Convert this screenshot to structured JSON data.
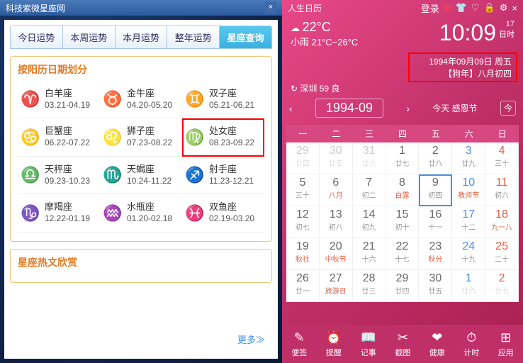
{
  "left": {
    "title": "科技紫微星座网",
    "tabs": [
      "今日运势",
      "本周运势",
      "本月运势",
      "整年运势",
      "星座查询"
    ],
    "activeTab": 4,
    "panel1_title": "按阳历日期划分",
    "zodiac": [
      {
        "icon": "♈",
        "name": "白羊座",
        "range": "03.21-04.19"
      },
      {
        "icon": "♉",
        "name": "金牛座",
        "range": "04.20-05.20"
      },
      {
        "icon": "♊",
        "name": "双子座",
        "range": "05.21-06.21"
      },
      {
        "icon": "♋",
        "name": "巨蟹座",
        "range": "06.22-07.22"
      },
      {
        "icon": "♌",
        "name": "狮子座",
        "range": "07.23-08.22"
      },
      {
        "icon": "♍",
        "name": "处女座",
        "range": "08.23-09.22"
      },
      {
        "icon": "♎",
        "name": "天秤座",
        "range": "09.23-10.23"
      },
      {
        "icon": "♏",
        "name": "天蝎座",
        "range": "10.24-11.22"
      },
      {
        "icon": "♐",
        "name": "射手座",
        "range": "11.23-12.21"
      },
      {
        "icon": "♑",
        "name": "摩羯座",
        "range": "12.22-01.19"
      },
      {
        "icon": "♒",
        "name": "水瓶座",
        "range": "01.20-02.18"
      },
      {
        "icon": "♓",
        "name": "双鱼座",
        "range": "02.19-03.20"
      }
    ],
    "highlight": 5,
    "panel2_title": "星座热文欣赏",
    "more": "更多≫"
  },
  "right": {
    "title": "人生日历",
    "login": "登录",
    "weather_icon": "☁",
    "temp": "22°C",
    "weather": "小雨 21°C~26°C",
    "time": "10:09",
    "day": "17",
    "day_label": "日时",
    "lunar_line1": "1994年09月09日 周五",
    "lunar_line2": "【狗年】八月初四",
    "loc_refresh": "↻",
    "loc": "深圳 59 良",
    "nav_month": "1994-09",
    "nav_today": "今天 感恩节",
    "today_btn": "今",
    "weekdays": [
      "一",
      "二",
      "三",
      "四",
      "五",
      "六",
      "日"
    ],
    "days": [
      {
        "n": "29",
        "l": "廿四",
        "c": "dim"
      },
      {
        "n": "30",
        "l": "廿五",
        "c": "dim"
      },
      {
        "n": "31",
        "l": "廿六",
        "c": "dim"
      },
      {
        "n": "1",
        "l": "廿七",
        "c": ""
      },
      {
        "n": "2",
        "l": "廿八",
        "c": ""
      },
      {
        "n": "3",
        "l": "廿九",
        "c": "sat"
      },
      {
        "n": "4",
        "l": "三十",
        "c": "sun"
      },
      {
        "n": "5",
        "l": "三十",
        "c": ""
      },
      {
        "n": "6",
        "l": "八月",
        "c": "hol"
      },
      {
        "n": "7",
        "l": "初二",
        "c": ""
      },
      {
        "n": "8",
        "l": "白露",
        "c": "hol"
      },
      {
        "n": "9",
        "l": "初四",
        "c": "sel"
      },
      {
        "n": "10",
        "l": "教师节",
        "c": "sat hol"
      },
      {
        "n": "11",
        "l": "初六",
        "c": "sun"
      },
      {
        "n": "12",
        "l": "初七",
        "c": ""
      },
      {
        "n": "13",
        "l": "初八",
        "c": ""
      },
      {
        "n": "14",
        "l": "初九",
        "c": ""
      },
      {
        "n": "15",
        "l": "初十",
        "c": ""
      },
      {
        "n": "16",
        "l": "十一",
        "c": ""
      },
      {
        "n": "17",
        "l": "十二",
        "c": "sat"
      },
      {
        "n": "18",
        "l": "九一八",
        "c": "sun hol"
      },
      {
        "n": "19",
        "l": "秋社",
        "c": "hol"
      },
      {
        "n": "20",
        "l": "中秋节",
        "c": "hol"
      },
      {
        "n": "21",
        "l": "十六",
        "c": ""
      },
      {
        "n": "22",
        "l": "十七",
        "c": ""
      },
      {
        "n": "23",
        "l": "秋分",
        "c": "hol"
      },
      {
        "n": "24",
        "l": "十九",
        "c": "sat"
      },
      {
        "n": "25",
        "l": "二十",
        "c": "sun"
      },
      {
        "n": "26",
        "l": "廿一",
        "c": ""
      },
      {
        "n": "27",
        "l": "旅游日",
        "c": "hol"
      },
      {
        "n": "28",
        "l": "廿三",
        "c": ""
      },
      {
        "n": "29",
        "l": "廿四",
        "c": ""
      },
      {
        "n": "30",
        "l": "廿五",
        "c": ""
      },
      {
        "n": "1",
        "l": "廿六",
        "c": "dim sat"
      },
      {
        "n": "2",
        "l": "廿七",
        "c": "dim sun"
      }
    ],
    "tools": [
      {
        "i": "✎",
        "t": "便签"
      },
      {
        "i": "⏰",
        "t": "提醒"
      },
      {
        "i": "📖",
        "t": "记事"
      },
      {
        "i": "✂",
        "t": "截图"
      },
      {
        "i": "❤",
        "t": "健康"
      },
      {
        "i": "⏱",
        "t": "计时"
      },
      {
        "i": "⊞",
        "t": "应用"
      }
    ]
  }
}
